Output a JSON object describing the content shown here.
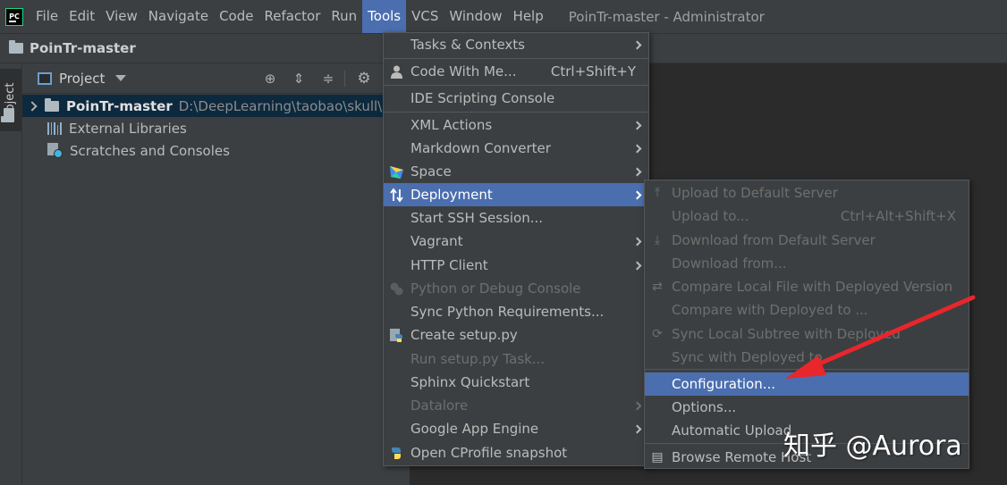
{
  "window_title": "PoinTr-master - Administrator",
  "menubar": {
    "items": [
      "File",
      "Edit",
      "View",
      "Navigate",
      "Code",
      "Refactor",
      "Run",
      "Tools",
      "VCS",
      "Window",
      "Help"
    ],
    "active": "Tools"
  },
  "navbar": {
    "project": "PoinTr-master"
  },
  "tool_stripe": {
    "project_label": "Project"
  },
  "project_panel": {
    "title": "Project",
    "root": {
      "name": "PoinTr-master",
      "path": "D:\\DeepLearning\\taobao\\skull\\Po"
    },
    "items": [
      "External Libraries",
      "Scratches and Consoles"
    ]
  },
  "tools_menu": {
    "items": [
      {
        "label": "Tasks & Contexts",
        "submenu": true
      },
      {
        "label": "Code With Me...",
        "shortcut": "Ctrl+Shift+Y"
      },
      {
        "label": "IDE Scripting Console"
      },
      {
        "label": "XML Actions",
        "submenu": true
      },
      {
        "label": "Markdown Converter",
        "submenu": true
      },
      {
        "label": "Space",
        "submenu": true
      },
      {
        "label": "Deployment",
        "submenu": true,
        "selected": true
      },
      {
        "label": "Start SSH Session..."
      },
      {
        "label": "Vagrant",
        "submenu": true
      },
      {
        "label": "HTTP Client",
        "submenu": true
      },
      {
        "label": "Python or Debug Console",
        "disabled": true
      },
      {
        "label": "Sync Python Requirements..."
      },
      {
        "label": "Create setup.py"
      },
      {
        "label": "Run setup.py Task...",
        "disabled": true
      },
      {
        "label": "Sphinx Quickstart"
      },
      {
        "label": "Datalore",
        "disabled": true,
        "submenu": true
      },
      {
        "label": "Google App Engine",
        "submenu": true
      },
      {
        "label": "Open CProfile snapshot"
      }
    ]
  },
  "deployment_menu": {
    "items": [
      {
        "label": "Upload to Default Server",
        "disabled": true
      },
      {
        "label": "Upload to...",
        "shortcut": "Ctrl+Alt+Shift+X",
        "disabled": true
      },
      {
        "label": "Download from Default Server",
        "disabled": true
      },
      {
        "label": "Download from...",
        "disabled": true
      },
      {
        "label": "Compare Local File with Deployed Version",
        "disabled": true
      },
      {
        "label": "Compare with Deployed to ...",
        "disabled": true
      },
      {
        "label": "Sync Local Subtree with Deployed",
        "disabled": true
      },
      {
        "label": "Sync with Deployed to",
        "disabled": true
      },
      {
        "label": "Configuration...",
        "selected": true
      },
      {
        "label": "Options..."
      },
      {
        "label": "Automatic Upload"
      },
      {
        "label": "Browse Remote Host"
      }
    ]
  },
  "watermark": "知乎 @Aurora",
  "colors": {
    "selection": "#4b6eaf",
    "annotation_arrow": "#e8262b",
    "panel_bg": "#3c3f41",
    "editor_bg": "#2b2b2b"
  }
}
